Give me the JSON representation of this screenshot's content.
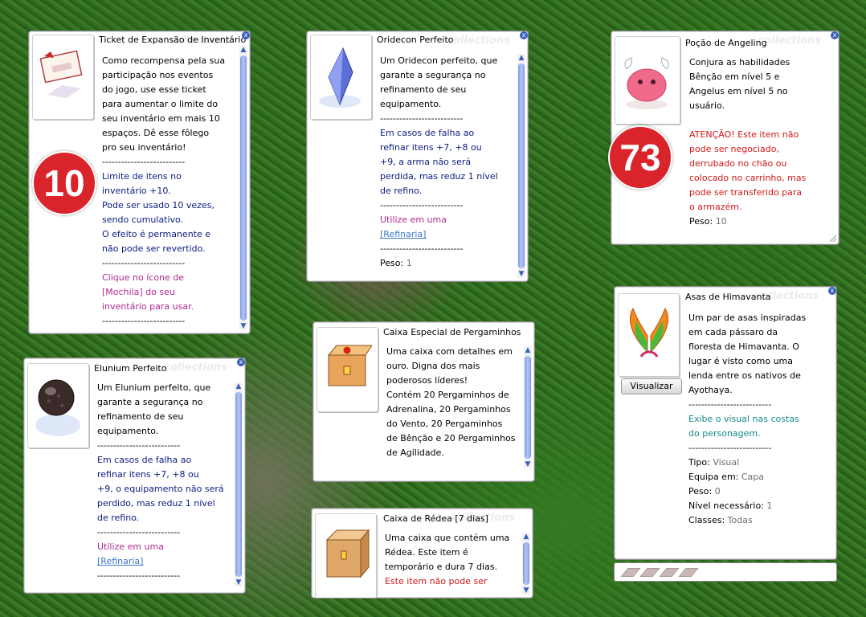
{
  "watermark": "collections",
  "close_glyph": "x",
  "scroll_up": "▲",
  "scroll_down": "▼",
  "items": [
    {
      "id": "ticket",
      "title": "Ticket de Expansão de Inventário",
      "icon": "ticket-icon",
      "badge": "10",
      "lines": [
        "Como recompensa pela sua",
        "participação nos eventos",
        "do jogo, use esse ticket",
        "para aumentar o limite do",
        "seu inventário em mais 10",
        "espaços. Dê esse fôlego",
        "pro seu inventário!",
        "--------------------------",
        "Limite de itens no",
        "inventário +10.",
        "Pode ser usado 10 vezes,",
        "sendo cumulativo.",
        "O efeito é permanente e",
        "não pode ser revertido.",
        "--------------------------",
        "Clique no ícone de",
        "[Mochila] do seu",
        "inventário para usar.",
        "--------------------------"
      ]
    },
    {
      "id": "oridecon",
      "title": "Oridecon Perfeito",
      "icon": "oridecon-crystal-icon",
      "lines": [
        "Um Oridecon perfeito, que",
        "garante a segurança no",
        "refinamento de seu",
        "equipamento.",
        "--------------------------",
        "Em casos de falha ao",
        "refinar itens +7, +8 ou",
        "+9, a arma não será",
        "perdida, mas reduz 1 nível",
        "de refino.",
        "--------------------------",
        "Utilize em uma",
        "[Refinaria]",
        "--------------------------",
        "Peso: ",
        "1"
      ]
    },
    {
      "id": "pocao",
      "title": "Poção de Angeling",
      "icon": "angeling-potion-icon",
      "badge": "73",
      "lines": [
        "Conjura as habilidades",
        "Bênção em nível 5 e",
        "Angelus em nível 5 no",
        "usuário.",
        "ATENÇÃO! Este item não",
        "pode ser negociado,",
        "derrubado no chão ou",
        "colocado no carrinho, mas",
        "pode ser transferido para",
        "o armazém.",
        "Peso: ",
        "10"
      ]
    },
    {
      "id": "elunium",
      "title": "Elunium Perfeito",
      "icon": "elunium-stone-icon",
      "lines": [
        "Um Elunium perfeito, que",
        "garante a segurança no",
        "refinamento de seu",
        "equipamento.",
        "--------------------------",
        "Em casos de falha ao",
        "refinar itens +7, +8 ou",
        "+9, o equipamento não será",
        "perdido, mas reduz 1 nível",
        "de refino.",
        "--------------------------",
        "Utilize em uma",
        "[Refinaria]",
        "--------------------------"
      ]
    },
    {
      "id": "caixa_perg",
      "title": "Caixa Especial de Pergaminhos",
      "icon": "scroll-box-icon",
      "lines": [
        "Uma caixa com detalhes em",
        "ouro. Digna dos mais",
        "poderosos líderes!",
        "Contém 20 Pergaminhos de",
        "Adrenalina, 20 Pergaminhos",
        "do Vento, 20 Pergaminhos",
        "de Bênção e 20 Pergaminhos",
        "de Agilidade."
      ]
    },
    {
      "id": "caixa_redea",
      "title": "Caixa de Rédea [7 dias]",
      "icon": "rein-box-icon",
      "lines": [
        "Uma caixa que contém uma",
        "Rédea. Este item é",
        "temporário e dura 7 dias.",
        "Este item não pode ser"
      ]
    },
    {
      "id": "asas",
      "title": "Asas de Himavanta",
      "icon": "himavanta-wings-icon",
      "button": "Visualizar",
      "lines": [
        "Um par de asas inspiradas",
        "em cada pássaro da",
        "floresta de Himavanta. O",
        "lugar é visto como uma",
        "lenda entre os nativos de",
        "Ayothaya.",
        "--------------------------",
        "Exibe o visual nas costas",
        "do personagem.",
        "--------------------------",
        "Tipo: ",
        "Visual",
        "Equipa em: ",
        "Capa",
        "Peso: ",
        "0",
        "Nível necessário: ",
        "1",
        "Classes: ",
        "Todas"
      ]
    }
  ]
}
